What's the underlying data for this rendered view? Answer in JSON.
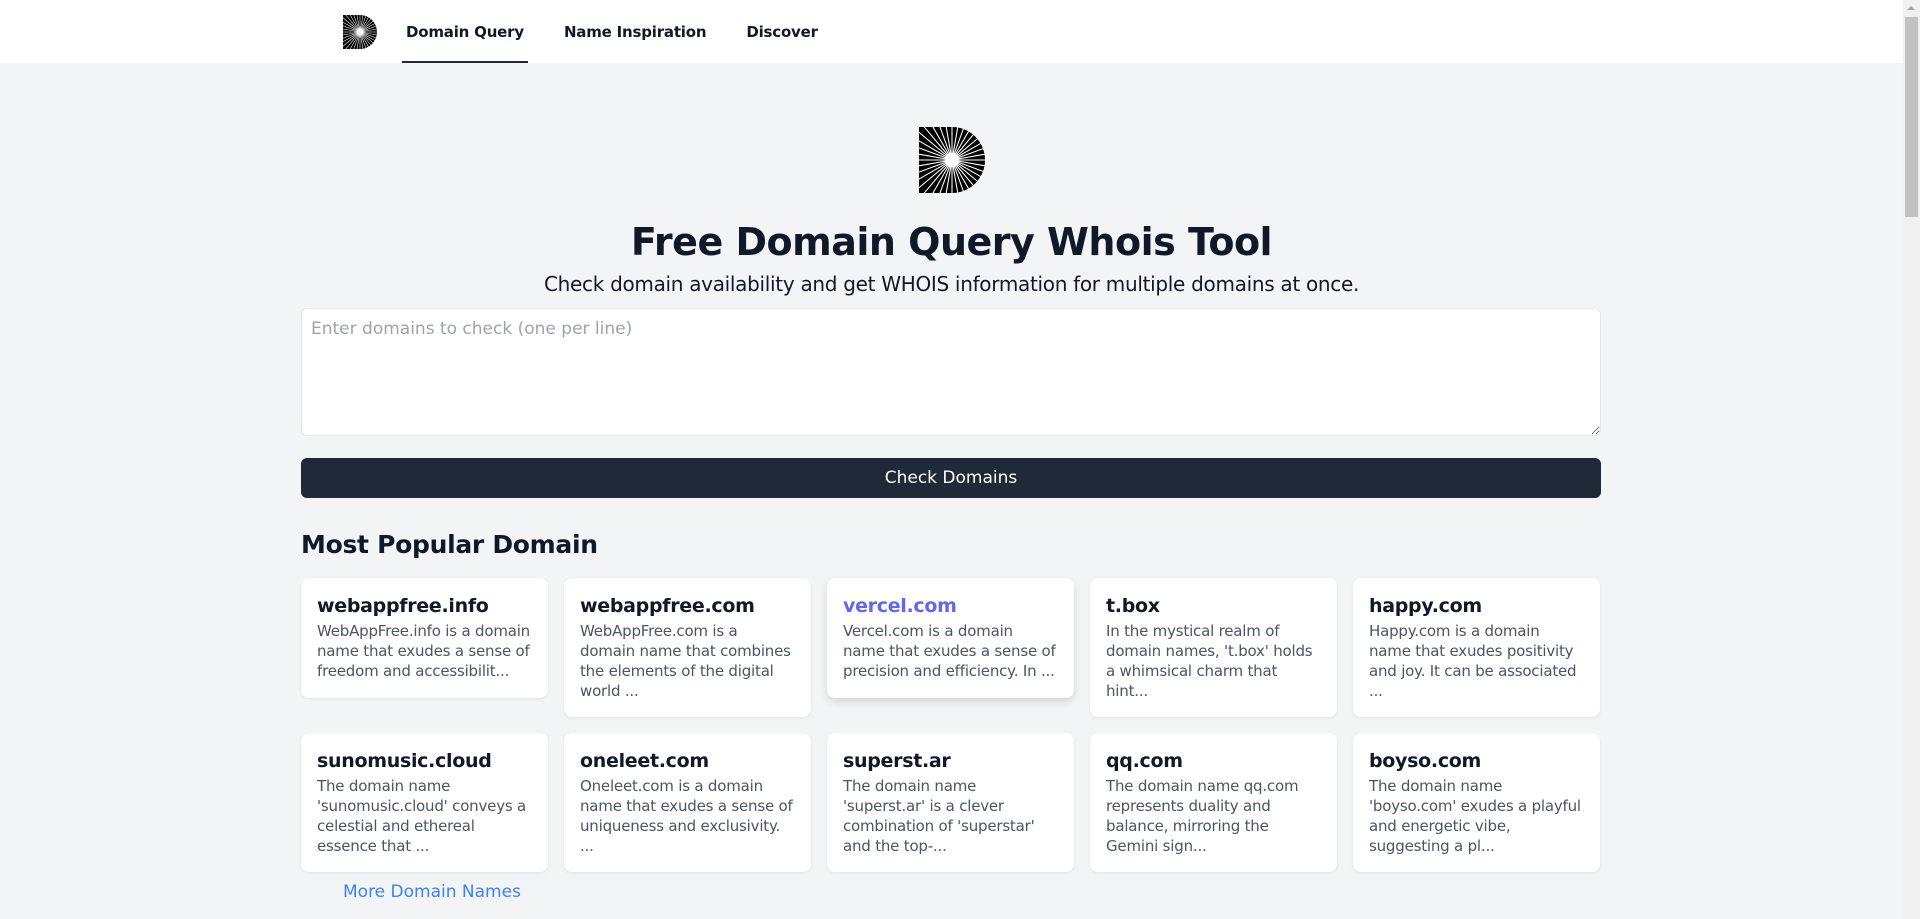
{
  "nav": {
    "logo": "brand-logo-icon",
    "tabs": [
      {
        "label": "Domain Query",
        "active": true
      },
      {
        "label": "Name Inspiration",
        "active": false
      },
      {
        "label": "Discover",
        "active": false
      }
    ]
  },
  "hero": {
    "logo": "brand-logo-icon",
    "title": "Free Domain Query Whois Tool",
    "subtitle": "Check domain availability and get WHOIS information for multiple domains at once."
  },
  "query": {
    "value": "",
    "placeholder": "Enter domains to check (one per line)",
    "button_label": "Check Domains"
  },
  "popular": {
    "title": "Most Popular Domain",
    "cards": [
      {
        "domain": "webappfree.info",
        "desc": "WebAppFree.info is a domain name that exudes a sense of freedom and accessibilit..."
      },
      {
        "domain": "webappfree.com",
        "desc": "WebAppFree.com is a domain name that combines the elements of the digital world ..."
      },
      {
        "domain": "vercel.com",
        "desc": "Vercel.com is a domain name that exudes a sense of precision and efficiency. In ..."
      },
      {
        "domain": "t.box",
        "desc": "In the mystical realm of domain names, 't.box' holds a whimsical charm that hint..."
      },
      {
        "domain": "happy.com",
        "desc": "Happy.com is a domain name that exudes positivity and joy. It can be associated ..."
      },
      {
        "domain": "sunomusic.cloud",
        "desc": "The domain name 'sunomusic.cloud' conveys a celestial and ethereal essence that ..."
      },
      {
        "domain": "oneleet.com",
        "desc": "Oneleet.com is a domain name that exudes a sense of uniqueness and exclusivity. ..."
      },
      {
        "domain": "superst.ar",
        "desc": "The domain name 'superst.ar' is a clever combination of 'superstar' and the top-..."
      },
      {
        "domain": "qq.com",
        "desc": "The domain name qq.com represents duality and balance, mirroring the Gemini sign..."
      },
      {
        "domain": "boyso.com",
        "desc": "The domain name 'boyso.com' exudes a playful and energetic vibe, suggesting a pl..."
      }
    ],
    "more_link": "More Domain Names"
  },
  "colors": {
    "background": "#f3f4f6",
    "primary_button": "#1f2937",
    "hover_title": "#6366f1",
    "link": "#3b82f6"
  }
}
